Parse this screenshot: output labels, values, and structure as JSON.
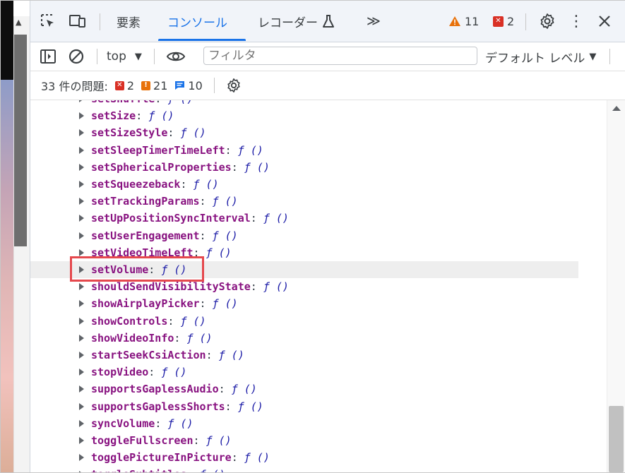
{
  "tabs": {
    "elements": "要素",
    "console": "コンソール",
    "recorder": "レコーダー",
    "more": "≫"
  },
  "counts": {
    "warnings": "11",
    "errors": "2"
  },
  "toolbar": {
    "context": "top",
    "filter_placeholder": "フィルタ",
    "levels": "デフォルト レベル"
  },
  "issues": {
    "label": "33 件の問題:",
    "errors": "2",
    "warnings": "21",
    "info": "10"
  },
  "console": {
    "fn_suffix": "ƒ ()",
    "rows": [
      "setShuffle",
      "setSize",
      "setSizeStyle",
      "setSleepTimerTimeLeft",
      "setSphericalProperties",
      "setSqueezeback",
      "setTrackingParams",
      "setUpPositionSyncInterval",
      "setUserEngagement",
      "setVideoTimeLeft",
      "setVolume",
      "shouldSendVisibilityState",
      "showAirplayPicker",
      "showControls",
      "showVideoInfo",
      "startSeekCsiAction",
      "stopVideo",
      "supportsGaplessAudio",
      "supportsGaplessShorts",
      "syncVolume",
      "toggleFullscreen",
      "togglePictureInPicture",
      "toggleSubtitles"
    ],
    "highlighted": "setVolume"
  },
  "colors": {
    "accent": "#1a73e8",
    "property": "#881280",
    "function": "#1a1aa6",
    "highlight_box": "#e5484d",
    "warning": "#e8710a",
    "error": "#d93025"
  }
}
